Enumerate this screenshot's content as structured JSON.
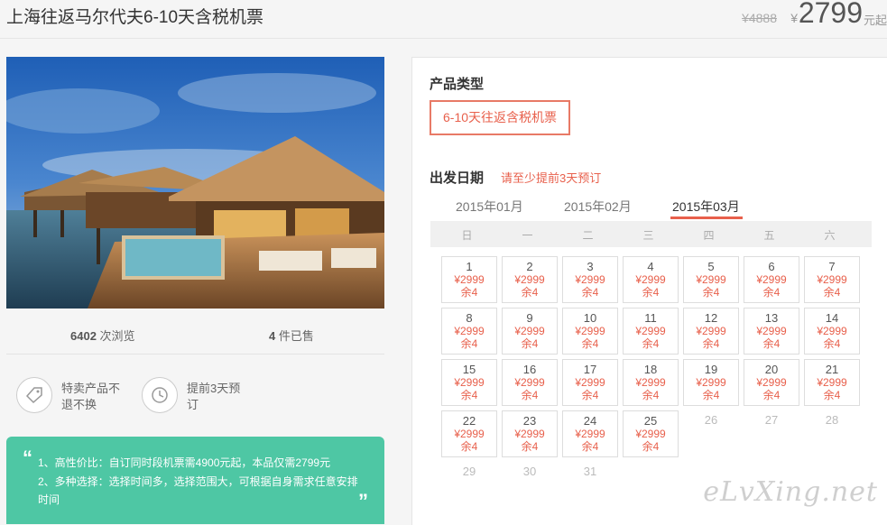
{
  "header": {
    "title": "上海往返马尔代夫6-10天含税机票",
    "old_price": "¥4888",
    "currency": "¥",
    "price": "2799",
    "price_unit": "元起"
  },
  "stats": {
    "views_count": "6402",
    "views_label": " 次浏览",
    "sold_count": "4",
    "sold_label": " 件已售"
  },
  "features": [
    {
      "icon": "tag-icon",
      "text": "特卖产品不退不换"
    },
    {
      "icon": "clock-icon",
      "text": "提前3天预订"
    }
  ],
  "promo": {
    "open_quote": "“",
    "line1": "1、高性价比：自订同时段机票需4900元起，本品仅需2799元",
    "line2": "2、多种选择：选择时间多，选择范围大，可根据自身需求任意安排时间",
    "close_quote": "”"
  },
  "booking": {
    "type_label": "产品类型",
    "type_option": "6-10天往返含税机票",
    "date_label": "出发日期",
    "date_tip": "请至少提前3天预订",
    "months": [
      "2015年01月",
      "2015年02月",
      "2015年03月"
    ],
    "active_month_index": 2,
    "weekdays": [
      "日",
      "一",
      "二",
      "三",
      "四",
      "五",
      "六"
    ],
    "available_days": [
      {
        "day": "1",
        "price": "¥2999",
        "remain": "余4"
      },
      {
        "day": "2",
        "price": "¥2999",
        "remain": "余4"
      },
      {
        "day": "3",
        "price": "¥2999",
        "remain": "余4"
      },
      {
        "day": "4",
        "price": "¥2999",
        "remain": "余4"
      },
      {
        "day": "5",
        "price": "¥2999",
        "remain": "余4"
      },
      {
        "day": "6",
        "price": "¥2999",
        "remain": "余4"
      },
      {
        "day": "7",
        "price": "¥2999",
        "remain": "余4"
      },
      {
        "day": "8",
        "price": "¥2999",
        "remain": "余4"
      },
      {
        "day": "9",
        "price": "¥2999",
        "remain": "余4"
      },
      {
        "day": "10",
        "price": "¥2999",
        "remain": "余4"
      },
      {
        "day": "11",
        "price": "¥2999",
        "remain": "余4"
      },
      {
        "day": "12",
        "price": "¥2999",
        "remain": "余4"
      },
      {
        "day": "13",
        "price": "¥2999",
        "remain": "余4"
      },
      {
        "day": "14",
        "price": "¥2999",
        "remain": "余4"
      },
      {
        "day": "15",
        "price": "¥2999",
        "remain": "余4"
      },
      {
        "day": "16",
        "price": "¥2999",
        "remain": "余4"
      },
      {
        "day": "17",
        "price": "¥2999",
        "remain": "余4"
      },
      {
        "day": "18",
        "price": "¥2999",
        "remain": "余4"
      },
      {
        "day": "19",
        "price": "¥2999",
        "remain": "余4"
      },
      {
        "day": "20",
        "price": "¥2999",
        "remain": "余4"
      },
      {
        "day": "21",
        "price": "¥2999",
        "remain": "余4"
      },
      {
        "day": "22",
        "price": "¥2999",
        "remain": "余4"
      },
      {
        "day": "23",
        "price": "¥2999",
        "remain": "余4"
      },
      {
        "day": "24",
        "price": "¥2999",
        "remain": "余4"
      },
      {
        "day": "25",
        "price": "¥2999",
        "remain": "余4"
      }
    ],
    "unavailable_days": [
      "26",
      "27",
      "28",
      "29",
      "30",
      "31"
    ]
  },
  "watermark": "eLvXing.net",
  "colors": {
    "accent": "#e8604c",
    "promo_bg": "#4ec7a4"
  }
}
